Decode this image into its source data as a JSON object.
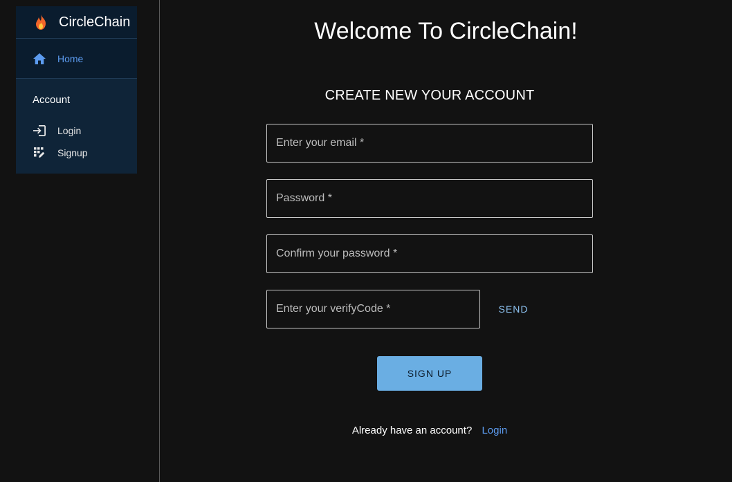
{
  "sidebar": {
    "brand": {
      "title": "CircleChain",
      "icon": "fire-icon"
    },
    "home": {
      "label": "Home",
      "icon": "home-icon"
    },
    "section_title": "Account",
    "items": [
      {
        "label": "Login",
        "icon": "login-icon"
      },
      {
        "label": "Signup",
        "icon": "signup-icon"
      }
    ]
  },
  "main": {
    "title": "Welcome To CircleChain!",
    "form_title": "CREATE NEW YOUR ACCOUNT",
    "fields": {
      "email": {
        "label": "Enter your email *",
        "value": ""
      },
      "password": {
        "label": "Password *",
        "value": ""
      },
      "confirm": {
        "label": "Confirm your password *",
        "value": ""
      },
      "verify": {
        "label": "Enter your verifyCode *",
        "value": ""
      }
    },
    "send_label": "SEND",
    "signup_label": "SIGN UP",
    "footer_text": "Already have an account?",
    "footer_link": "Login"
  },
  "colors": {
    "background": "#121212",
    "sidebar": "#0f2438",
    "accent": "#5c9bef",
    "button": "#6aaee3"
  }
}
